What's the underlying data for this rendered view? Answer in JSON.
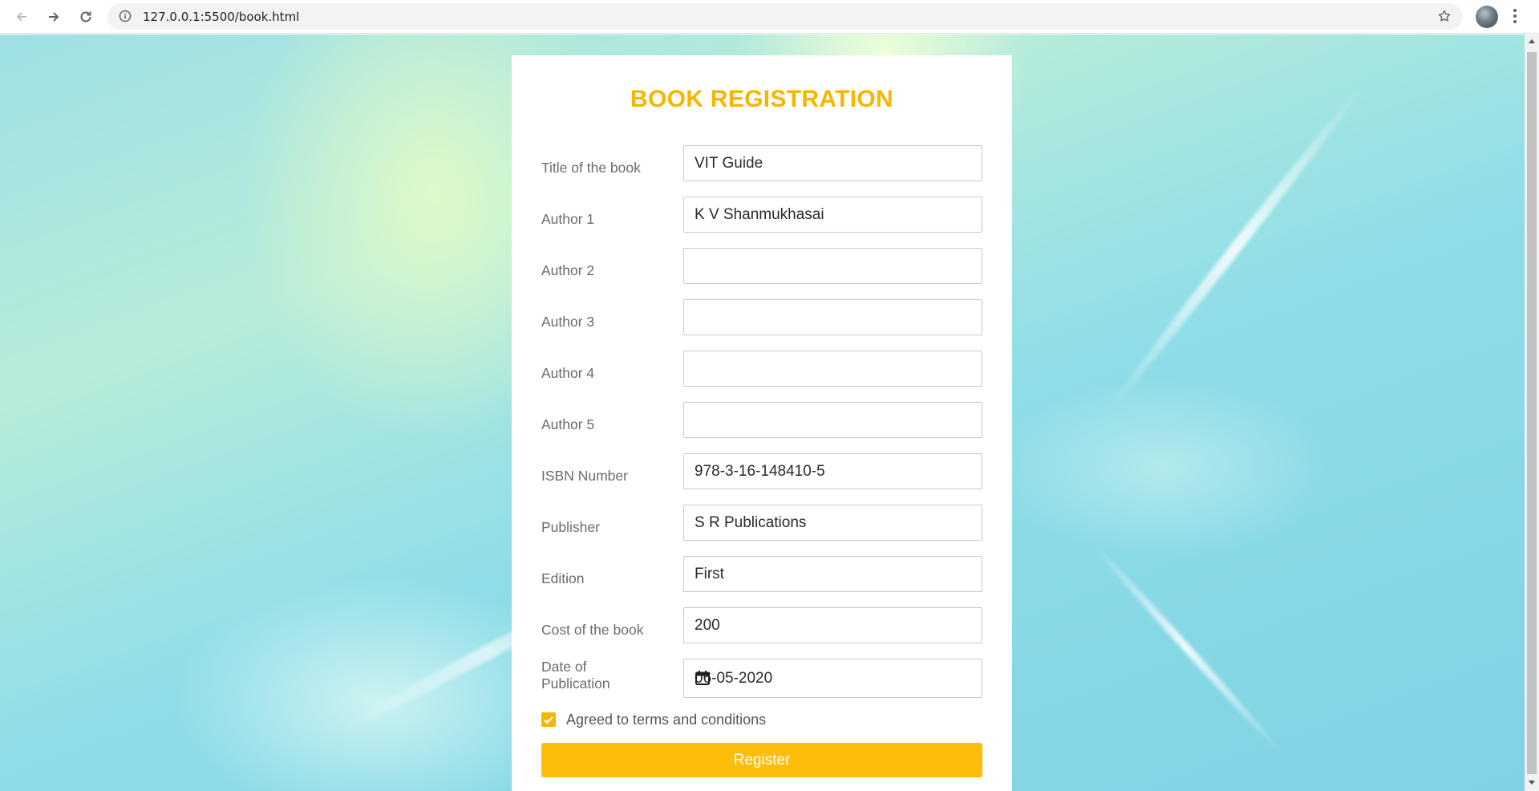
{
  "browser": {
    "url": "127.0.0.1:5500/book.html"
  },
  "form": {
    "title": "BOOK REGISTRATION",
    "fields": [
      {
        "label": "Title of the book",
        "value": "VIT Guide"
      },
      {
        "label": "Author 1",
        "value": "K V Shanmukhasai"
      },
      {
        "label": "Author 2",
        "value": ""
      },
      {
        "label": "Author 3",
        "value": ""
      },
      {
        "label": "Author 4",
        "value": ""
      },
      {
        "label": "Author 5",
        "value": ""
      },
      {
        "label": "ISBN Number",
        "value": "978-3-16-148410-5"
      },
      {
        "label": "Publisher",
        "value": "S R Publications"
      },
      {
        "label": "Edition",
        "value": "First"
      },
      {
        "label": "Cost of the book",
        "value": "200"
      }
    ],
    "date": {
      "label_line1": "Date of",
      "label_line2": "Publication",
      "value": "06-05-2020"
    },
    "terms": {
      "label": "Agreed to terms and conditions",
      "checked": true
    },
    "submit_label": "Register"
  },
  "colors": {
    "accent": "#f7b500",
    "button": "#fdbd0b"
  }
}
